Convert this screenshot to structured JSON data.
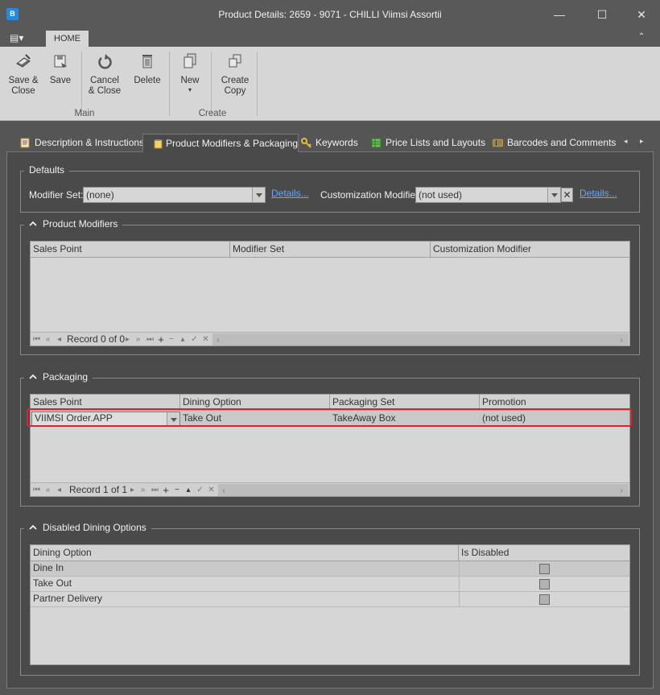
{
  "window": {
    "title": "Product Details: 2659 - 9071 - CHILLI Viimsi Assortii",
    "app_icon": "app-icon",
    "minimize": "—",
    "maximize": "☐",
    "close": "✕"
  },
  "ribbon": {
    "menu_icon": "▤▾",
    "tab": "HOME",
    "collapse": "⌃",
    "buttons": {
      "save_close_1": "Save &",
      "save_close_2": "Close",
      "save": "Save",
      "cancel_close_1": "Cancel",
      "cancel_close_2": "& Close",
      "delete": "Delete",
      "new": "New",
      "new_arrow": "▾",
      "create_copy_1": "Create",
      "create_copy_2": "Copy"
    },
    "groups": {
      "main": "Main",
      "create": "Create"
    }
  },
  "doc_tabs": {
    "items": [
      "Description & Instructions",
      "Product Modifiers & Packaging",
      "Keywords",
      "Price Lists and Layouts",
      "Barcodes and Comments"
    ],
    "scroll_left": "◂",
    "scroll_right": "▸",
    "active": "Product Modifiers & Packaging"
  },
  "defaults": {
    "title": "Defaults",
    "modifier_set_label": "Modifier Set:",
    "modifier_set_value": "(none)",
    "details_link": "Details...",
    "customization_label": "Customization Modifier:",
    "customization_value": "(not used)",
    "clear": "✕"
  },
  "product_modifiers": {
    "title": "Product Modifiers",
    "columns": [
      "Sales Point",
      "Modifier Set",
      "Customization Modifier"
    ],
    "record_text": "Record 0 of 0"
  },
  "packaging": {
    "title": "Packaging",
    "columns": [
      "Sales Point",
      "Dining Option",
      "Packaging Set",
      "Promotion"
    ],
    "rows": [
      {
        "sales_point": "VIIMSI Order.APP",
        "dining_option": "Take Out",
        "packaging_set": "TakeAway Box",
        "promotion": "(not used)"
      }
    ],
    "record_text": "Record 1 of 1"
  },
  "navigator": {
    "first": "⏮",
    "prev_page": "«",
    "prev": "◂",
    "next": "▸",
    "next_page": "»",
    "last": "⏭",
    "add": "+",
    "remove": "−",
    "up": "▴",
    "check": "✓",
    "cancel": "✕",
    "scroll_left": "‹",
    "scroll_right": "›"
  },
  "disabled_dining": {
    "title": "Disabled Dining Options",
    "columns": [
      "Dining Option",
      "Is Disabled"
    ],
    "rows": [
      {
        "option": "Dine In",
        "disabled": false
      },
      {
        "option": "Take Out",
        "disabled": false
      },
      {
        "option": "Partner Delivery",
        "disabled": false
      }
    ]
  },
  "colors": {
    "titlebar": "#595959",
    "ribbon": "#d6d6d6",
    "workspace": "#4a4a4a",
    "highlight": "#d9232d",
    "link": "#6aa6ff"
  }
}
